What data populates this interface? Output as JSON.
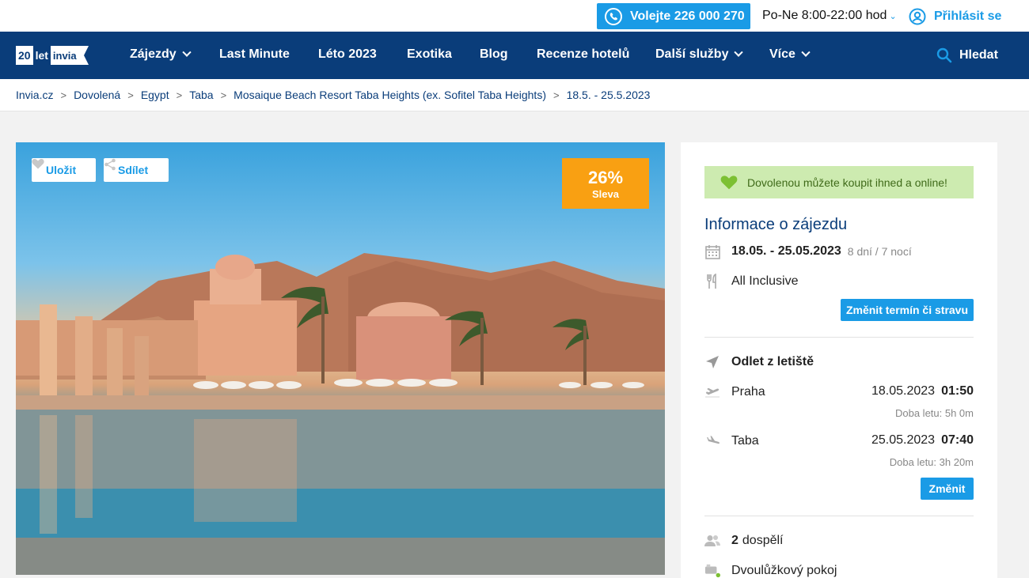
{
  "topbar": {
    "call_label": "Volejte 226 000 270",
    "hours": "Po-Ne 8:00-22:00 hod",
    "login": "Přihlásit se"
  },
  "logo": {
    "num": "20",
    "let": "let",
    "brand": "invia"
  },
  "nav": {
    "items": [
      "Zájezdy",
      "Last Minute",
      "Léto 2023",
      "Exotika",
      "Blog",
      "Recenze hotelů",
      "Další služby",
      "Více"
    ],
    "search": "Hledat"
  },
  "breadcrumb": [
    "Invia.cz",
    "Dovolená",
    "Egypt",
    "Taba",
    "Mosaique Beach Resort Taba Heights (ex. Sofitel Taba Heights)",
    "18.5. - 25.5.2023"
  ],
  "hero": {
    "save": "Uložit",
    "share": "Sdílet",
    "discount_pct": "26%",
    "discount_label": "Sleva"
  },
  "panel": {
    "banner": "Dovolenou můžete koupit ihned a online!",
    "title": "Informace o zájezdu",
    "dates": "18.05. - 25.05.2023",
    "length": "8 dní / 7 nocí",
    "board": "All Inclusive",
    "change_term": "Změnit termín či stravu",
    "departure_heading": "Odlet z letiště",
    "outbound": {
      "city": "Praha",
      "date": "18.05.2023",
      "time": "01:50",
      "duration": "Doba letu: 5h 0m"
    },
    "inbound": {
      "city": "Taba",
      "date": "25.05.2023",
      "time": "07:40",
      "duration": "Doba letu: 3h 20m"
    },
    "change": "Změnit",
    "adults_count": "2",
    "adults_label": "dospělí",
    "room": "Dvoulůžkový pokoj"
  },
  "colors": {
    "brand": "#0a3d7a",
    "accent": "#1a9be6",
    "discount": "#f9a012",
    "banner_bg": "#cdebb0"
  }
}
